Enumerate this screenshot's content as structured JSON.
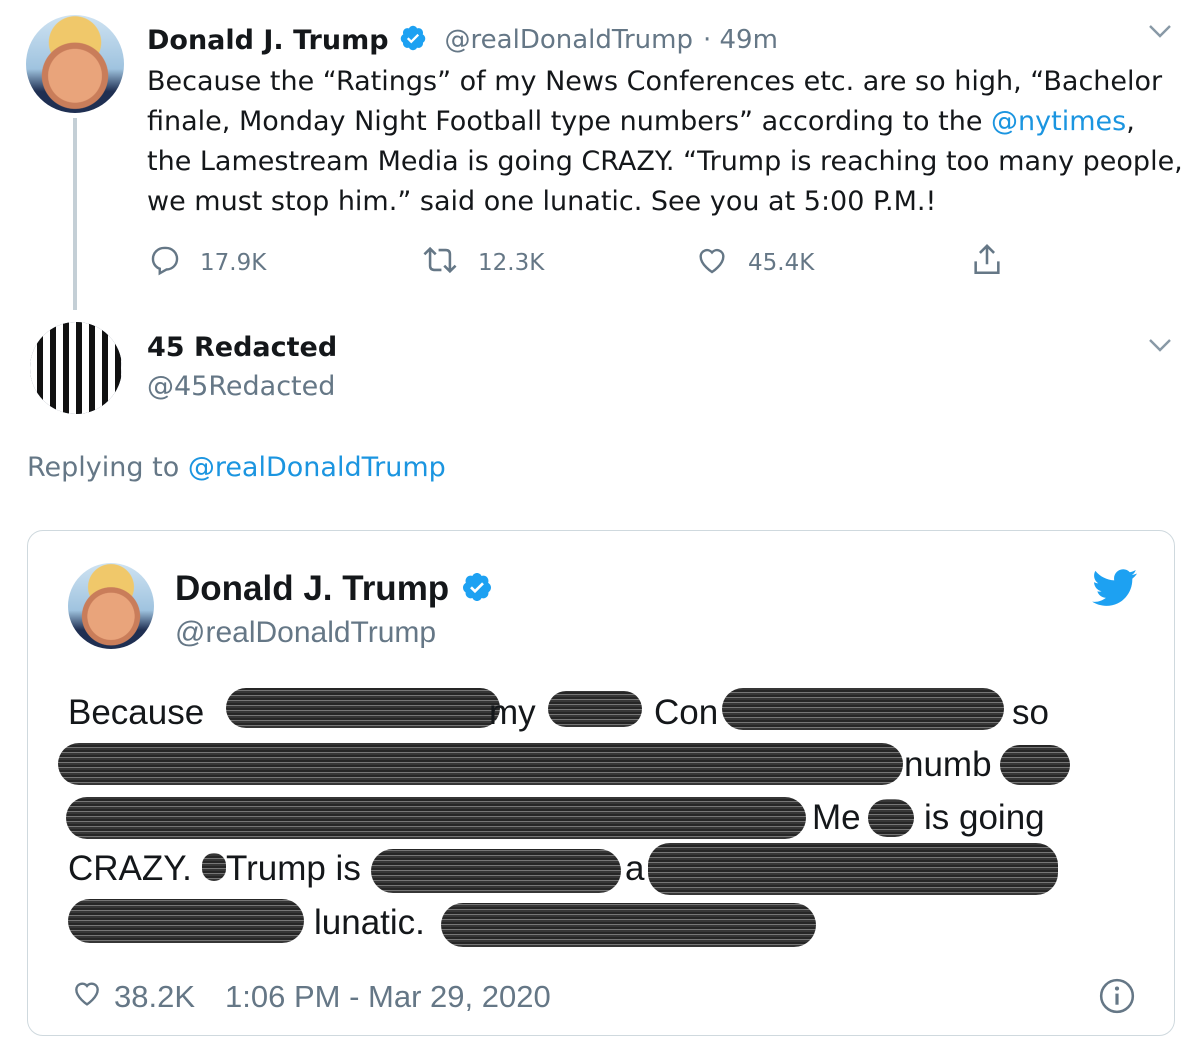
{
  "tweet1": {
    "name": "Donald J. Trump",
    "handle": "@realDonaldTrump",
    "time": "· 49m",
    "text_lines": [
      "Because the “Ratings” of my News Conferences etc. are so high, “Bachelor",
      "finale, Monday Night Football type numbers” according to the ",
      "the Lamestream Media is going CRAZY. “Trump is reaching too many people,",
      "we must stop him.” said one lunatic. See you at 5:00 P.M.!"
    ],
    "mention": "@nytimes",
    "mention_suffix": ",",
    "replies": "17.9K",
    "retweets": "12.3K",
    "likes": "45.4K"
  },
  "tweet2": {
    "name": "45 Redacted",
    "handle": "@45Redacted",
    "replying_prefix": "Replying to ",
    "replying_handle": "@realDonaldTrump"
  },
  "embed": {
    "name": "Donald J. Trump",
    "handle": "@realDonaldTrump",
    "words": {
      "because": "Because",
      "my": "my",
      "con": "Con",
      "so": "so",
      "numb": "numb",
      "me": "Me",
      "is_going": "is going",
      "crazy": "CRAZY.",
      "trump_is": "Trump is",
      "a": "a",
      "lunatic": "lunatic."
    },
    "likes": "38.2K",
    "timestamp": "1:06 PM - Mar 29, 2020"
  },
  "colors": {
    "link": "#1b95e0",
    "muted": "#657786",
    "verified": "#1da1f2",
    "twitter_bird": "#1da1f2"
  },
  "icons": [
    "verified-badge-icon",
    "chevron-down-icon",
    "reply-icon",
    "retweet-icon",
    "like-icon",
    "share-icon",
    "twitter-bird-icon",
    "info-icon"
  ]
}
